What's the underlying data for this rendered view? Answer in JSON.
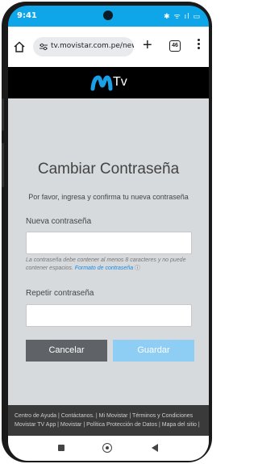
{
  "status_bar": {
    "time": "9:41",
    "icons": "✱ ᯤ ıl ▭"
  },
  "browser": {
    "url": "tv.movistar.com.pe/newPa",
    "tab_count": "46",
    "new_tab_label": "+"
  },
  "brand": {
    "logo_text": "Tv",
    "logo_color": "#19a0e6"
  },
  "form": {
    "title": "Cambiar Contraseña",
    "subtitle": "Por favor, ingresa y confirma tu nueva contraseña",
    "new_password_label": "Nueva contraseña",
    "new_password_value": "",
    "hint_text": "La contraseña debe contener al menos 8 caracteres y no puede contener espacios.",
    "hint_link": "Formato de contraseña",
    "hint_icon": "ⓘ",
    "repeat_password_label": "Repetir contraseña",
    "repeat_password_value": "",
    "cancel_label": "Cancelar",
    "save_label": "Guardar"
  },
  "footer": {
    "text": "Centro de Ayuda  |  Contáctanos.  |  Mi Movistar  |  Términos y Condiciones Movistar TV App  |  Movistar  |  Política Protección de Datos  |  Mapa del sitio  |"
  },
  "colors": {
    "status_bar": "#0ea5e9",
    "content_bg": "#d7dadd",
    "cancel_button": "#5f6368",
    "save_button": "#8ecdf4"
  }
}
